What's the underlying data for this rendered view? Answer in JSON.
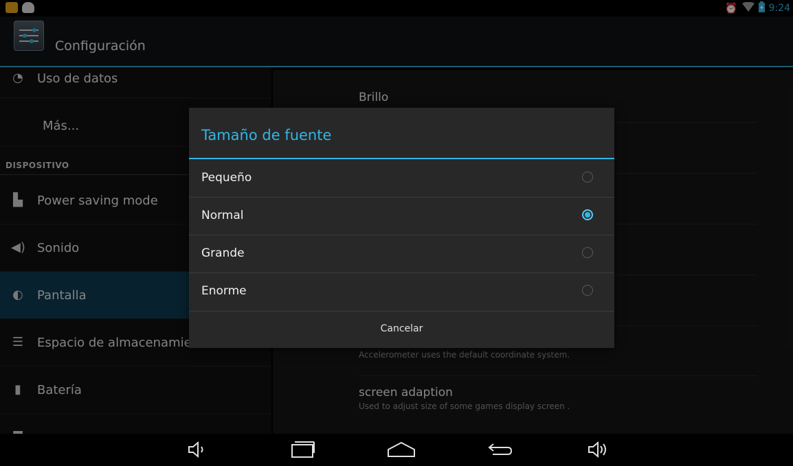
{
  "status": {
    "time": "9:24",
    "left_icons": [
      "app-notification-icon",
      "android-notification-icon"
    ],
    "right_icons": [
      "alarm-icon",
      "wifi-icon",
      "battery-charging-icon"
    ]
  },
  "app": {
    "title": "Configuración",
    "accent_color": "#33b5e5"
  },
  "sidebar": {
    "items": [
      {
        "label": "Uso de datos",
        "icon": "data-usage-icon"
      },
      {
        "label": "Más...",
        "icon": ""
      },
      {
        "label": "Power saving mode",
        "icon": "power-saving-icon"
      },
      {
        "label": "Sonido",
        "icon": "sound-icon"
      },
      {
        "label": "Pantalla",
        "icon": "display-icon",
        "selected": true
      },
      {
        "label": "Espacio de almacenamie",
        "icon": "storage-icon"
      },
      {
        "label": "Batería",
        "icon": "battery-icon"
      }
    ],
    "section_header": "DISPOSITIVO"
  },
  "display_settings": {
    "items": [
      {
        "title": "Brillo",
        "subtitle": ""
      },
      {
        "title": "",
        "subtitle": "Accelerometer uses the default coordinate system."
      },
      {
        "title": "screen adaption",
        "subtitle": "Used to adjust size of some games display screen ."
      }
    ]
  },
  "dialog": {
    "title": "Tamaño de fuente",
    "options": [
      {
        "label": "Pequeño",
        "selected": false
      },
      {
        "label": "Normal",
        "selected": true
      },
      {
        "label": "Grande",
        "selected": false
      },
      {
        "label": "Enorme",
        "selected": false
      }
    ],
    "cancel_label": "Cancelar"
  },
  "navbar": {
    "buttons": [
      "volume-down-icon",
      "recent-apps-icon",
      "home-icon",
      "back-icon",
      "volume-up-icon"
    ]
  }
}
